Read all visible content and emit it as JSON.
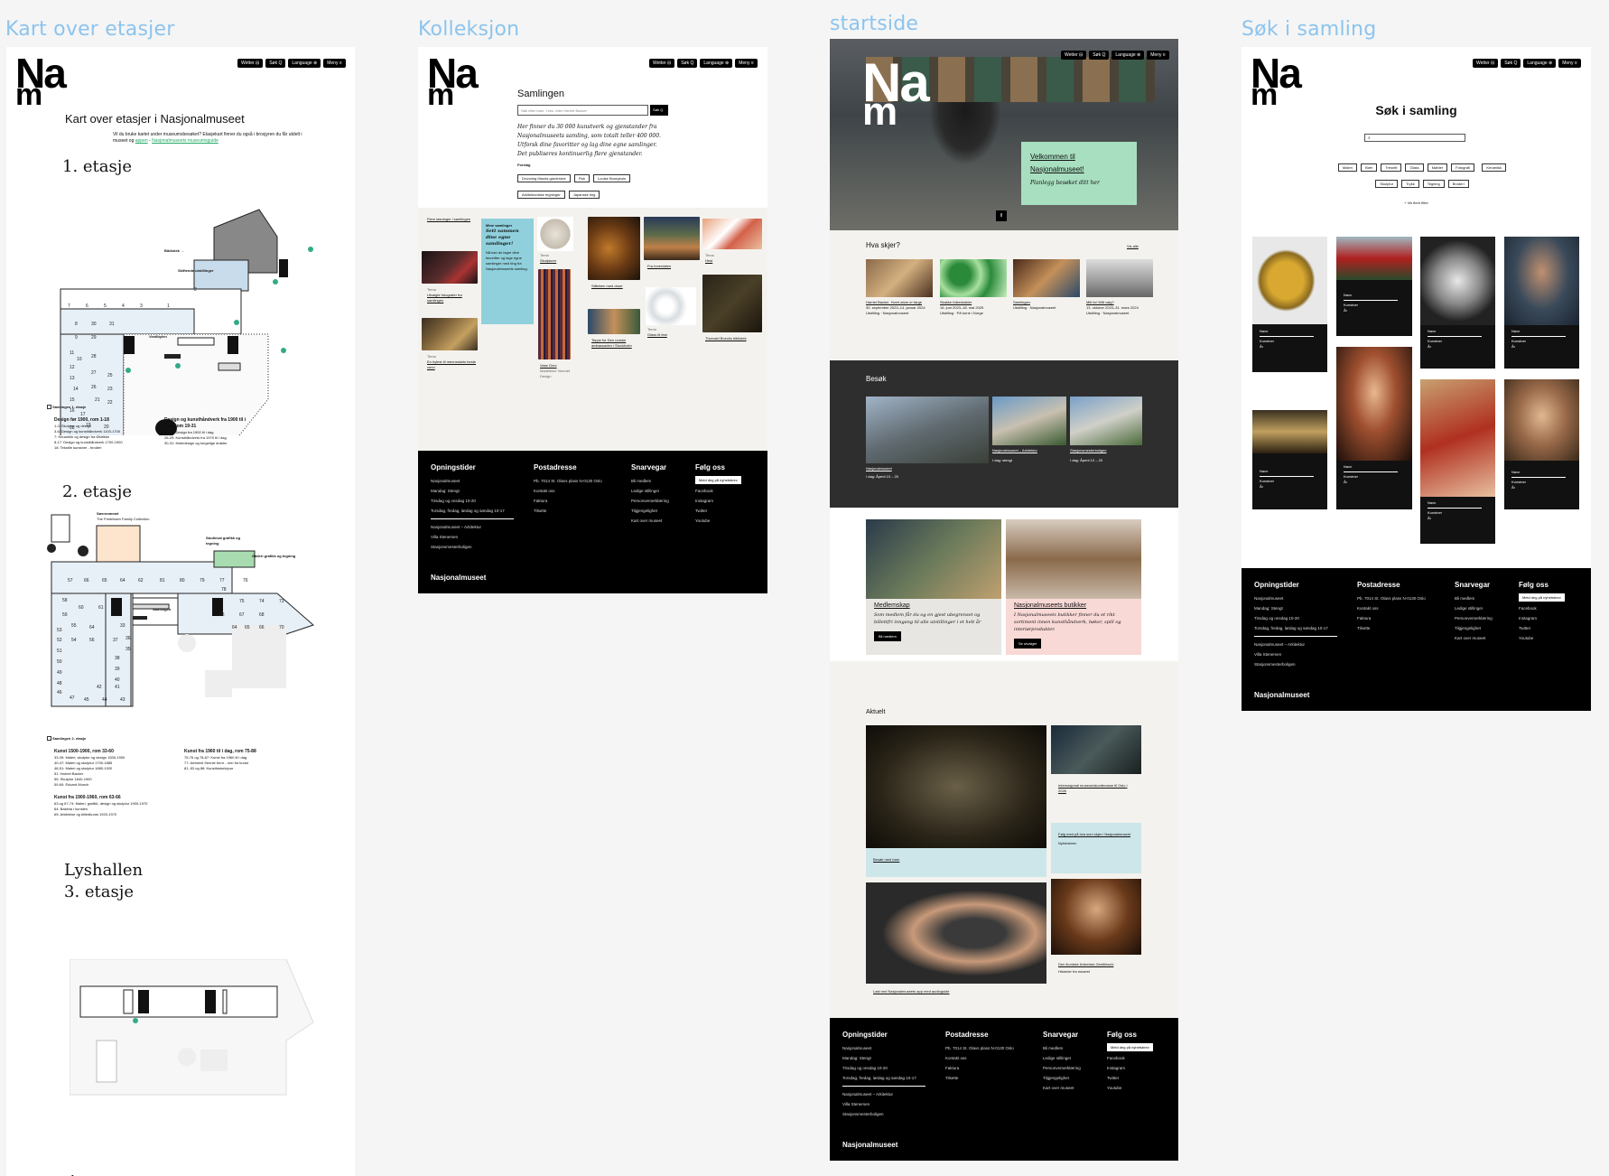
{
  "frames": {
    "floors_title": "Kart over etasjer",
    "collection_title": "Kolleksjon",
    "home_title": "startside",
    "search_title": "Søk i samling"
  },
  "logo": {
    "line1": "Na",
    "line2": "m"
  },
  "topnav": [
    "Wetter ⊟",
    "Søk Q",
    "Language ⊕",
    "Meny ≡"
  ],
  "floors": {
    "heading": "Kart over etasjer i Nasjonalmuseet",
    "intro_1": "Vil du bruke kartet under museumsbesøket? Etasjekart finner du også i brosjyren du",
    "intro_2": "får utdelt i museet og",
    "intro_link_1": "appen",
    "intro_link_2": "Nasjonalmuseets museumsguide",
    "floor1": "1. etasje",
    "floor1_labels": {
      "bibliotek": "Bibliotek →",
      "skiftende": "Skiftende utstillinger",
      "vestibylen": "Vestibylen"
    },
    "floor1_rooms": [
      "7",
      "6",
      "5",
      "4",
      "3",
      "1",
      "2",
      "8",
      "30",
      "31",
      "9",
      "29",
      "11",
      "10",
      "28",
      "12",
      "27",
      "13",
      "14",
      "26",
      "15",
      "21",
      "22",
      "16",
      "17",
      "18",
      "23",
      "25",
      "19",
      "20"
    ],
    "floor1_legend_title": "Samlingen 1. etasje",
    "floor1_legend_a_title": "Design før 1900, rom 1-18",
    "floor1_legend_a_items": [
      "1-2: Skulptur og design",
      "3-6: Design og kunsthåndverk 1100-1700",
      "7: Keramikk og design fra Østrikke",
      "8-17: Design og kunsthåndverk 1700-1900",
      "18: Tekstile kunstner - broderi"
    ],
    "floor1_legend_b_title": "Design og kunsthåndverk fra 1900 til i dag, rom 19-31",
    "floor1_legend_b_items": [
      "19-25: Design fra 1900 til i dag",
      "26-29: Kunsthåndverk fra 1970 til i dag",
      "30-31: Motedesign og tongelige drakter"
    ],
    "floor2": "2. etasje",
    "floor2_labels": {
      "sover": "Søvnrommet",
      "sover_sub": "The Fredriksen Family Collection",
      "studiesal": "Studiesal grafikk og tegning",
      "galleri": "Galleri grafikk og tegning",
      "samlingen": "Samlingen"
    },
    "floor2_rooms": [
      "57",
      "66",
      "65",
      "64",
      "62",
      "81",
      "80",
      "79",
      "77",
      "76",
      "78",
      "58",
      "75",
      "74",
      "73",
      "60",
      "61",
      "59",
      "63",
      "67",
      "68",
      "53",
      "55",
      "64",
      "65",
      "66",
      "70",
      "52",
      "54",
      "56",
      "37",
      "36",
      "51",
      "35",
      "50",
      "38",
      "49",
      "39",
      "48",
      "40",
      "46",
      "47",
      "42",
      "41",
      "45",
      "44",
      "43"
    ],
    "floor2_legend_title": "Samlingen 2. etasje",
    "floor2_legend_a_title": "Kunst 1500-1900, rom 33-60",
    "floor2_legend_a_items": [
      "33-39: Maleri, skulptur og design 1500-1900",
      "40-47: Maleri og skulptur 1700-1885",
      "48-51: Maleri og skulptur 1880-1920",
      "51: Harriet Backer",
      "55: Skulptur 1840-1900",
      "59-60: Edvard Munch"
    ],
    "floor2_legend_b_title": "Kunst fra 1960 til i dag, rom 75-88",
    "floor2_legend_b_items": [
      "75-76 og 78-87: Kunst fra 1960 til i dag",
      "77: Ambient Sennie fornr - rom for kunst",
      "81, 83 og 88: Kunsthistoriejour"
    ],
    "floor2_legend_c_title": "Kunst fra 1900-1960, rom 63-66",
    "floor2_legend_c_items": [
      "63 og 67-74: Maleri, grafikk, design og skulptur 1900-1970",
      "64: Bakkha i kunsten",
      "65: Arkitektur og billedkunst 1920-1970"
    ],
    "floor3_a": "Lyshallen",
    "floor3_b": "3. etasje",
    "basement": "-1"
  },
  "collection": {
    "heading": "Samlingen",
    "search_placeholder": "Søk etter bare, f.eks. etter Harriet Backer",
    "search_button": "Søk Q",
    "desc_1": "Her finner du 30 000 kunstverk og gjenstander fra",
    "desc_2": "Nasjonalmuseets samling, som totalt teller 400 000.",
    "desc_3": "Utforsk dine favoritter og lag dine egne samlinger.",
    "desc_4": "Det publiseres kontinuerlig flere gjenstander.",
    "tags_label": "Forslag",
    "tags": [
      "Dronning Mauds garderobe",
      "Fisk",
      "Louise Bourgeois",
      "Arkitektoniske tegninger",
      "Japanske ting"
    ],
    "cards": {
      "flere": "Flere løsninger i samlingen",
      "mine_title": "Mine samlinger",
      "mine_sub": "Sett sammen dine egne samlinger!",
      "mine_text": "Nå kan du lagre dine favoritter og lage egne samlinger med ting fra Nasjonalmuseets samling.",
      "skulpturer": "Skulpturer",
      "skulpturer_kicker": "Tema",
      "stillebe": "Stilleben med druer",
      "fra_innerdalen": "Fra Innerdalen",
      "hest": "Hest",
      "hest_kicker": "Tema",
      "fotografer": "Utvalgte fotografer fra samlingen",
      "fotografer_kicker": "Tema",
      "hylest": "En hylest til menneskets beste venn",
      "hylest_kicker": "Tema",
      "glass": "Glass til fest",
      "glass_kicker": "Tema",
      "teppe": "Teppe for Den norske ambassaden i Stockholm",
      "thorvald": "Thorvald Boecks bibliotek",
      "vase": "Vase Grec",
      "vase_meta": "Madeleine Vionnet Design"
    }
  },
  "home": {
    "hero_title_1": "Velkommen til",
    "hero_title_2": "Nasjonalmuseet!",
    "hero_sub": "Planlegg besøket ditt her",
    "pause": "II",
    "hva_skjer": "Hva skjer?",
    "vis_alle": "Vis alle",
    "events": [
      {
        "title": "Harriet Backer. Hvert atom er farge",
        "date": "30. september 2023–14. januar 2024",
        "type": "Utstilling · Nasjonalmuseet"
      },
      {
        "title": "Skakke folkedrakter",
        "date": "16. juni 2023–18. mai 2025",
        "type": "Utstilling · På turné i Norge"
      },
      {
        "title": "Samlingen",
        "date": "",
        "type": "Utstilling · Nasjonalmuseet"
      },
      {
        "title": "Mitt liv! Mitt valg?",
        "date": "13. oktober 2023–31. mars 2024",
        "type": "Utstilling · Nasjonalmuseet"
      }
    ],
    "besok": "Besøk",
    "venues": [
      {
        "title": "Nasjonalmuseet",
        "hours": "I dag: Åpent 10 – 20"
      },
      {
        "title": "Nasjonalmuseet – Arkitektur",
        "hours": "I dag: stengt"
      },
      {
        "title": "Stasjonsmesterboligen",
        "hours": "I dag: Åpent 10 – 20"
      }
    ],
    "medlemskap": "Medlemskap",
    "medlemskap_text": "Som medlem får du og en gjest ubegrenset og billettfri inngang til alle utstillinger i et helt år",
    "medlemskap_btn": "Bli medlem",
    "butikk": "Nasjonalmuseets butikker",
    "butikk_text": "I Nasjonalmuseets butikker finner du et rikt sortiment innen kunsthåndverk, bøker, spill og interiørprodukter.",
    "butikk_btn": "Se utvalget",
    "aktuelt": "Aktuelt",
    "news": [
      {
        "title": "Besøk med barn"
      },
      {
        "title": "Internasjonal museumskonferanse til Oslo i 2026"
      },
      {
        "title": "Følg med på hva som skjer i Nasjonalmuseet",
        "meta": "Nyhetsbrev"
      },
      {
        "title": "Last ned Nasjonalmuseets app med audioguide"
      },
      {
        "title": "Den ikoniske Artemisia Gentileschi",
        "meta": "Historier fra museet"
      }
    ]
  },
  "search": {
    "heading": "Søk i samling",
    "filters": [
      "Maleri",
      "Klær",
      "Tresnitt",
      "Glass",
      "Møbler",
      "Fotografi",
      "Keramikk",
      "Skulptur",
      "Trykk",
      "Tegning",
      "Broderi"
    ],
    "more_filters": "+ Vis flere filtre",
    "result_name": "Navn",
    "result_artist": "Kunstner",
    "result_year": "År"
  },
  "footer": {
    "col1_title": "Opningstider",
    "col1_items": [
      "Nasjonalmuseet",
      "Mandag: Stengt",
      "Tirsdag og onsdag 10-20",
      "Torsdag, fredag, lørdag og søndag 10-17"
    ],
    "col1_extra": [
      "Nasjonalmuseet – Arkitektur",
      "Villa Stenersen",
      "Stasjonsmesterboligen"
    ],
    "col2_title": "Postadresse",
    "col2_items": [
      "Pb. 7014 St. Olavs plass N-0130 Oslo",
      "Kontakt oss",
      "Faktura",
      "Tilsette"
    ],
    "col3_title": "Snarvegar",
    "col3_items": [
      "Bli medlem",
      "Ledige stillinger",
      "Personvernerklæring",
      "Tilgjengelighet",
      "Kart over museet"
    ],
    "col4_title": "Følg oss",
    "col4_button": "Meld deg på nyhetsbrev",
    "col4_items": [
      "Facebook",
      "Instagram",
      "Twitter",
      "Youtube"
    ],
    "brand": "Nasjonalmuseet"
  },
  "colors": {
    "accent_green": "#a8dfc0",
    "accent_blue": "#8fd0dc",
    "accent_pink": "#f8d9d6",
    "map_blue": "#c9dcec",
    "map_orange": "#fde4cc",
    "map_green": "#a8dcb0",
    "title_blue": "#8cc4ee"
  }
}
